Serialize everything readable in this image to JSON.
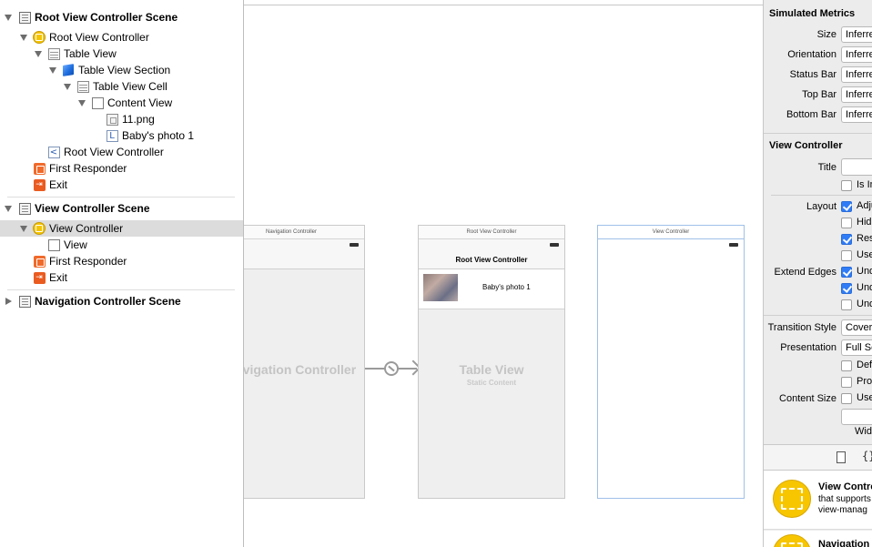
{
  "outline": {
    "rows": [
      {
        "label": "Root View Controller Scene",
        "icon": "scene-icon"
      },
      {
        "label": "Root View Controller",
        "icon": "view-controller-icon"
      },
      {
        "label": "Table View",
        "icon": "table-view-icon"
      },
      {
        "label": "Table View Section",
        "icon": "table-section-cube-icon"
      },
      {
        "label": "Table View Cell",
        "icon": "table-cell-icon"
      },
      {
        "label": "Content View",
        "icon": "view-icon"
      },
      {
        "label": "11.png",
        "icon": "image-icon"
      },
      {
        "label": "Baby's photo 1",
        "icon": "label-icon"
      },
      {
        "label": "Root View Controller",
        "icon": "nav-item-icon"
      },
      {
        "label": "First Responder",
        "icon": "first-responder-icon"
      },
      {
        "label": "Exit",
        "icon": "exit-icon"
      },
      {
        "label": "View Controller Scene",
        "icon": "scene-icon"
      },
      {
        "label": "View Controller",
        "icon": "view-controller-icon"
      },
      {
        "label": "View",
        "icon": "view-icon"
      },
      {
        "label": "First Responder",
        "icon": "first-responder-icon"
      },
      {
        "label": "Exit",
        "icon": "exit-icon"
      },
      {
        "label": "Navigation Controller Scene",
        "icon": "scene-icon"
      }
    ],
    "icon_glyphs": {
      "label": "L",
      "back": "<",
      "exit": "⇥"
    }
  },
  "canvas": {
    "nav_scene": {
      "title": "Navigation Controller",
      "body_label": "Navigation Controller"
    },
    "root_scene": {
      "title": "Root View Controller",
      "navbar_title": "Root View Controller",
      "cell_text": "Baby's photo 1",
      "body_label": "Table View",
      "body_sub": "Static Content"
    },
    "vc_scene": {
      "title": "View Controller"
    }
  },
  "inspector": {
    "simulated_metrics": {
      "title": "Simulated Metrics",
      "rows": [
        {
          "label": "Size",
          "value": "Inferred"
        },
        {
          "label": "Orientation",
          "value": "Inferred"
        },
        {
          "label": "Status Bar",
          "value": "Inferred"
        },
        {
          "label": "Top Bar",
          "value": "Inferred"
        },
        {
          "label": "Bottom Bar",
          "value": "Inferred"
        }
      ]
    },
    "view_controller": {
      "title": "View Controller",
      "title_label": "Title",
      "title_value": "",
      "is_initial_label": "Is Initial View Controller",
      "layout_label": "Layout",
      "layout_checks": [
        {
          "label": "Adjust Scroll View Insets",
          "checked": true
        },
        {
          "label": "Hide Bottom Bar on Push",
          "checked": false
        },
        {
          "label": "Resize View From NIB",
          "checked": true
        },
        {
          "label": "Use Full Screen (Deprecated)",
          "checked": false
        }
      ],
      "extend_edges_label": "Extend Edges",
      "extend_checks": [
        {
          "label": "Under Top Bars",
          "checked": true
        },
        {
          "label": "Under Bottom Bars",
          "checked": true
        },
        {
          "label": "Under Opaque Bars",
          "checked": false
        }
      ],
      "transition_style_label": "Transition Style",
      "transition_style_value": "Cover Vertical",
      "presentation_label": "Presentation",
      "presentation_value": "Full Screen",
      "defines_context_label": "Defines Context",
      "provides_context_label": "Provides Context",
      "content_size_label": "Content Size",
      "use_preferred_label": "Use Preferred Explicit Size",
      "width_label": "Width"
    },
    "library_tabs": {
      "file_icon": "file-icon",
      "braces_glyph": "{}"
    },
    "library": [
      {
        "title": "View Controller",
        "desc1": "that supports",
        "desc2": "view-manag"
      },
      {
        "title": "Navigation"
      }
    ]
  },
  "colors": {
    "selection": "#dcdcdc",
    "checkbox_on": "#2f7cf6",
    "vc_icon": "#f5c400",
    "responder": "#f06a2a"
  }
}
